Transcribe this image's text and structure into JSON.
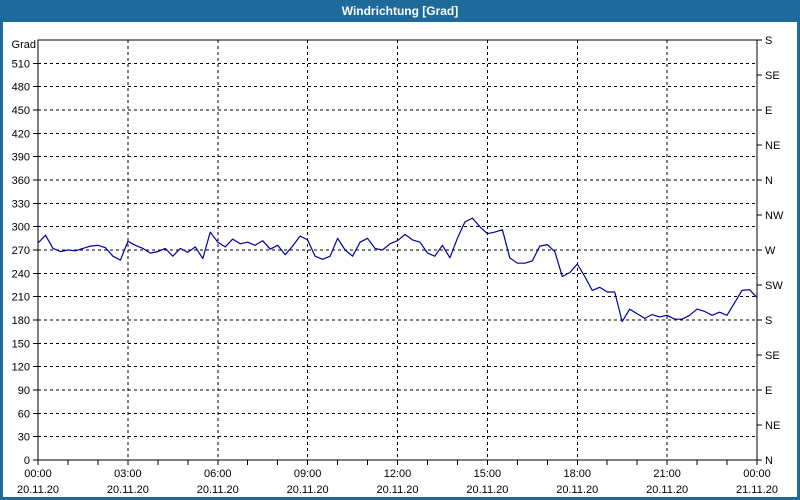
{
  "window": {
    "title": "Windrichtung [Grad]"
  },
  "colors": {
    "titlebar": "#1E6B9B",
    "window_border": "#1E6B9B",
    "background": "#ffffff",
    "line": "#0000A0",
    "grid": "#000000",
    "frame": "#000000",
    "text": "#000000",
    "title_text": "#ffffff"
  },
  "chart_data": {
    "type": "line",
    "title": "Windrichtung [Grad]",
    "grid": "dashed",
    "legend": "none",
    "y_axis": {
      "label": "Grad",
      "min": 0,
      "max": 540,
      "tick_step": 30,
      "tick_labels": [
        0,
        30,
        60,
        90,
        120,
        150,
        180,
        210,
        240,
        270,
        300,
        330,
        360,
        390,
        420,
        450,
        480,
        510
      ]
    },
    "right_axis": {
      "labels": [
        {
          "deg": 0,
          "label": "N"
        },
        {
          "deg": 45,
          "label": "NE"
        },
        {
          "deg": 90,
          "label": "E"
        },
        {
          "deg": 135,
          "label": "SE"
        },
        {
          "deg": 180,
          "label": "S"
        },
        {
          "deg": 225,
          "label": "SW"
        },
        {
          "deg": 270,
          "label": "W"
        },
        {
          "deg": 315,
          "label": "NW"
        },
        {
          "deg": 360,
          "label": "N"
        },
        {
          "deg": 405,
          "label": "NE"
        },
        {
          "deg": 450,
          "label": "E"
        },
        {
          "deg": 495,
          "label": "SE"
        },
        {
          "deg": 540,
          "label": "S"
        }
      ]
    },
    "x_axis": {
      "min_hour": 0,
      "max_hour": 24,
      "minor_tick_hours": 1,
      "label_step_hours": 3,
      "ticks": [
        {
          "time": "00:00",
          "date": "20.11.20"
        },
        {
          "time": "03:00",
          "date": "20.11.20"
        },
        {
          "time": "06:00",
          "date": "20.11.20"
        },
        {
          "time": "09:00",
          "date": "20.11.20"
        },
        {
          "time": "12:00",
          "date": "20.11.20"
        },
        {
          "time": "15:00",
          "date": "20.11.20"
        },
        {
          "time": "18:00",
          "date": "20.11.20"
        },
        {
          "time": "21:00",
          "date": "20.11.20"
        },
        {
          "time": "00:00",
          "date": "21.11.20"
        }
      ]
    },
    "series": [
      {
        "name": "Windrichtung",
        "unit": "Grad",
        "color": "#0000A0",
        "points_start_hour": 0,
        "points_interval_hours": 0.25,
        "values": [
          279,
          289,
          272,
          268,
          270,
          269,
          272,
          275,
          276,
          273,
          262,
          257,
          281,
          276,
          272,
          266,
          268,
          272,
          262,
          272,
          267,
          274,
          259,
          293,
          280,
          274,
          284,
          278,
          280,
          276,
          282,
          271,
          276,
          264,
          275,
          288,
          283,
          262,
          258,
          262,
          285,
          270,
          262,
          280,
          285,
          272,
          270,
          278,
          282,
          290,
          283,
          280,
          266,
          262,
          276,
          260,
          285,
          306,
          311,
          300,
          291,
          293,
          296,
          260,
          253,
          253,
          256,
          275,
          277,
          268,
          236,
          241,
          252,
          236,
          218,
          222,
          216,
          216,
          178,
          194,
          188,
          182,
          187,
          184,
          186,
          181,
          181,
          186,
          194,
          191,
          186,
          190,
          186,
          202,
          218,
          219,
          209
        ]
      }
    ]
  }
}
